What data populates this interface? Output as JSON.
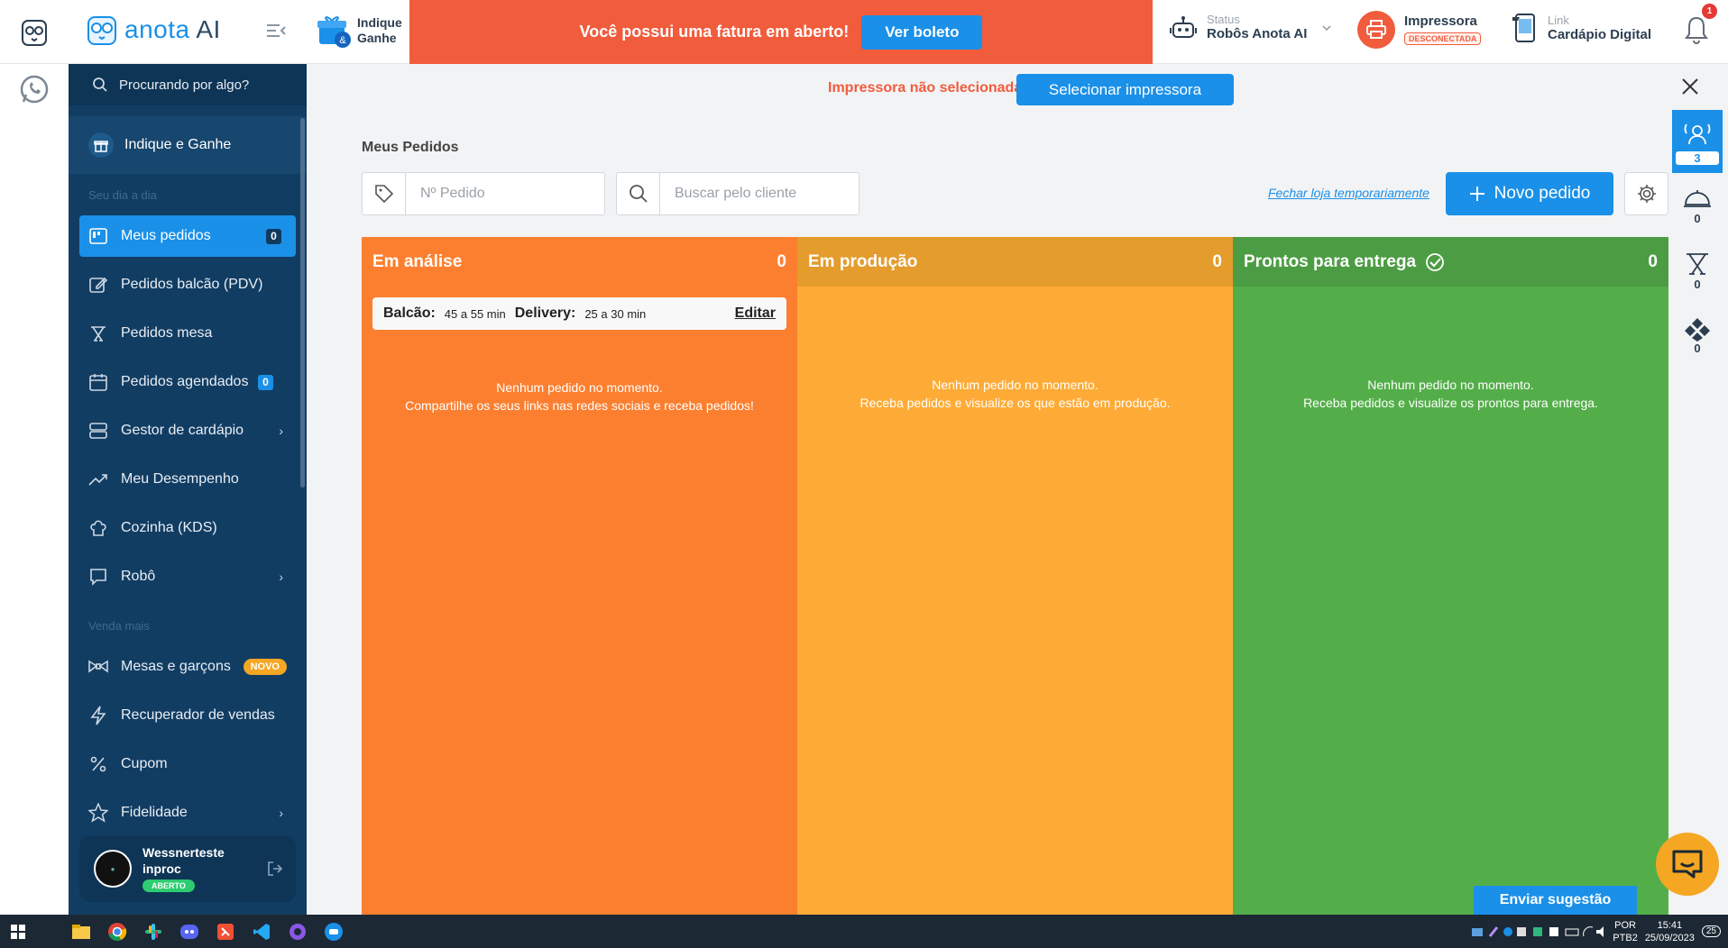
{
  "topbar": {
    "logo_text": "anota",
    "logo_ai": "AI",
    "indique_line1": "Indique",
    "indique_line2": "Ganhe",
    "banner_message": "Você possui uma fatura em aberto!",
    "banner_button": "Ver boleto",
    "status_label": "Status",
    "status_value": "Robôs Anota AI",
    "printer_label": "Impressora",
    "printer_state": "DESCONECTADA",
    "link_label": "Link",
    "link_value": "Cardápio Digital",
    "notifications_count": "1"
  },
  "sidebar": {
    "search_placeholder": "Procurando por algo?",
    "indique": "Indique e Ganhe",
    "section_day": "Seu dia a dia",
    "section_sell": "Venda mais",
    "items": [
      {
        "label": "Meus pedidos",
        "count": "0"
      },
      {
        "label": "Pedidos balcão (PDV)"
      },
      {
        "label": "Pedidos mesa"
      },
      {
        "label": "Pedidos agendados",
        "count": "0"
      },
      {
        "label": "Gestor de cardápio"
      },
      {
        "label": "Meu Desempenho"
      },
      {
        "label": "Cozinha (KDS)"
      },
      {
        "label": "Robô"
      },
      {
        "label": "Mesas e garçons",
        "badge": "NOVO"
      },
      {
        "label": "Recuperador de vendas"
      },
      {
        "label": "Cupom"
      },
      {
        "label": "Fidelidade"
      }
    ],
    "user": {
      "name_line1": "Wessnerteste",
      "name_line2": "inproc",
      "status": "ABERTO"
    }
  },
  "main": {
    "printer_warning": "Impressora não selecionada",
    "select_printer": "Selecionar impressora",
    "title": "Meus Pedidos",
    "order_number_placeholder": "Nº Pedido",
    "client_search_placeholder": "Buscar pelo cliente",
    "close_store": "Fechar loja temporariamente",
    "new_order": "Novo pedido",
    "columns": [
      {
        "title": "Em análise",
        "count": "0",
        "empty_line1": "Nenhum pedido no momento.",
        "empty_line2": "Compartilhe os seus links nas redes sociais e receba pedidos!"
      },
      {
        "title": "Em produção",
        "count": "0",
        "empty_line1": "Nenhum pedido no momento.",
        "empty_line2": "Receba pedidos e visualize os que estão em produção."
      },
      {
        "title": "Prontos para entrega",
        "count": "0",
        "empty_line1": "Nenhum pedido no momento.",
        "empty_line2": "Receba pedidos e visualize os prontos para entrega."
      }
    ],
    "times": {
      "balcao_label": "Balcão:",
      "balcao_value": "45 a 55 min",
      "delivery_label": "Delivery:",
      "delivery_value": "25 a 30 min",
      "edit": "Editar"
    }
  },
  "right_rail": {
    "counts": [
      "3",
      "0",
      "0",
      "0"
    ]
  },
  "feedback_button": "Enviar sugestão",
  "taskbar": {
    "lang1": "POR",
    "lang2": "PTB2",
    "time": "15:41",
    "date": "25/09/2023",
    "notif": "25"
  },
  "colors": {
    "accent": "#1a90e8",
    "banner": "#f15c3d",
    "sidebar": "#123d63",
    "analysis": "#fc7f2f",
    "production": "#fdab36",
    "ready": "#53ae49"
  }
}
